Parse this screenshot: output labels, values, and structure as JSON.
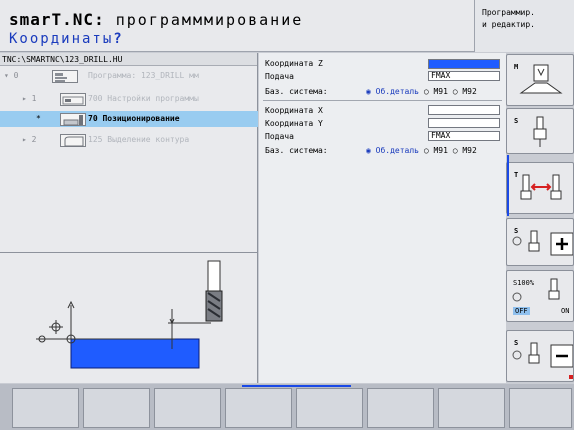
{
  "header": {
    "mode_title_bold": "smarT.NC:",
    "mode_title_rest": " программмирование",
    "prompt": "Координаты",
    "prompt_suffix": "?",
    "side_mode_line1": "Программир.",
    "side_mode_line2": "и редактир."
  },
  "tree": {
    "path": "TNC:\\SMARTNC\\123_DRILL.HU",
    "rows": [
      {
        "mark": "▾ 0",
        "num": "",
        "label": "Программа: 123_DRILL мм"
      },
      {
        "mark": "▸ 1",
        "num": "",
        "label": "700 Настройки программы"
      },
      {
        "mark": "*",
        "num": "",
        "label": "70 Позиционирование"
      },
      {
        "mark": "▸ 2",
        "num": "",
        "label": "125 Выделение контура"
      }
    ]
  },
  "form": {
    "coord_z_label": "Координата Z",
    "coord_z_value": "",
    "feed1_label": "Подача",
    "feed1_value": "FMAX",
    "base1_label": "Баз. система:",
    "base1_opt1": "◉ Об.деталь",
    "base1_opt2": "○ M91",
    "base1_opt3": "○ M92",
    "coord_x_label": "Координата X",
    "coord_x_value": "",
    "coord_y_label": "Координата Y",
    "coord_y_value": "",
    "feed2_label": "Подача",
    "feed2_value": "FMAX",
    "base2_label": "Баз. система:",
    "base2_opt1": "◉ Об.деталь",
    "base2_opt2": "○ M91",
    "base2_opt3": "○ M92"
  },
  "softkeys_right": {
    "m_label": "M",
    "s1_label": "S",
    "t_label": "T",
    "s2_label": "S",
    "s100_label": "S100%",
    "off_label": "OFF",
    "on_label": "ON",
    "s3_label": "S"
  },
  "colors": {
    "accent": "#1a49e6",
    "selected_row": "#99ccf0",
    "workpiece": "#1f5cff"
  }
}
